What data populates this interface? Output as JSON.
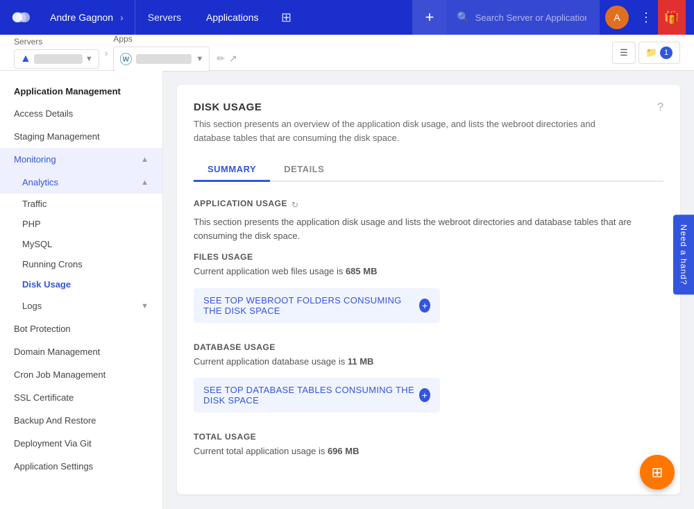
{
  "topnav": {
    "user": "Andre Gagnon",
    "nav_items": [
      "Servers",
      "Applications"
    ],
    "active_nav": "Applications",
    "search_placeholder": "Search Server or Application",
    "add_label": "+",
    "avatar_letter": "A"
  },
  "subheader": {
    "servers_label": "Servers",
    "apps_label": "Apps",
    "file_btn_label": "☰",
    "folder_btn_label": "📁",
    "badge_count": "1"
  },
  "sidebar": {
    "section_title": "Application Management",
    "items": [
      {
        "label": "Access Details",
        "active": false,
        "has_children": false
      },
      {
        "label": "Staging Management",
        "active": false,
        "has_children": false
      },
      {
        "label": "Monitoring",
        "active": true,
        "has_children": true,
        "expanded": true
      },
      {
        "label": "Analytics",
        "active": true,
        "has_children": true,
        "expanded": true,
        "is_sub": true
      },
      {
        "label": "Bot Protection",
        "active": false,
        "has_children": false
      },
      {
        "label": "Domain Management",
        "active": false,
        "has_children": false
      },
      {
        "label": "Cron Job Management",
        "active": false,
        "has_children": false
      },
      {
        "label": "SSL Certificate",
        "active": false,
        "has_children": false
      },
      {
        "label": "Backup And Restore",
        "active": false,
        "has_children": false
      },
      {
        "label": "Deployment Via Git",
        "active": false,
        "has_children": false
      },
      {
        "label": "Application Settings",
        "active": false,
        "has_children": false
      }
    ],
    "analytics_sub_items": [
      {
        "label": "Traffic",
        "active": false
      },
      {
        "label": "PHP",
        "active": false
      },
      {
        "label": "MySQL",
        "active": false
      },
      {
        "label": "Running Crons",
        "active": false
      },
      {
        "label": "Disk Usage",
        "active": true
      }
    ],
    "logs_label": "Logs"
  },
  "content": {
    "title": "DISK USAGE",
    "description": "This section presents an overview of the application disk usage, and lists the webroot directories and database tables that are consuming the disk space.",
    "tabs": [
      "SUMMARY",
      "DETAILS"
    ],
    "active_tab": "SUMMARY",
    "app_usage_title": "APPLICATION USAGE",
    "app_usage_desc": "This section presents the application disk usage and lists the webroot directories and database tables that are consuming the disk space.",
    "files_section": {
      "title": "FILES USAGE",
      "desc_prefix": "Current application web files usage is ",
      "value": "685 MB",
      "button": "See Top Webroot Folders Consuming The Disk Space"
    },
    "db_section": {
      "title": "DATABASE USAGE",
      "desc_prefix": "Current application database usage is ",
      "value": "11 MB",
      "button": "See Top Database Tables Consuming The Disk Space"
    },
    "total_section": {
      "title": "TOTAL USAGE",
      "desc_prefix": "Current total application usage is ",
      "value": "696 MB"
    }
  },
  "need_hand": "Need a hand?",
  "fab_icon": "⊞"
}
